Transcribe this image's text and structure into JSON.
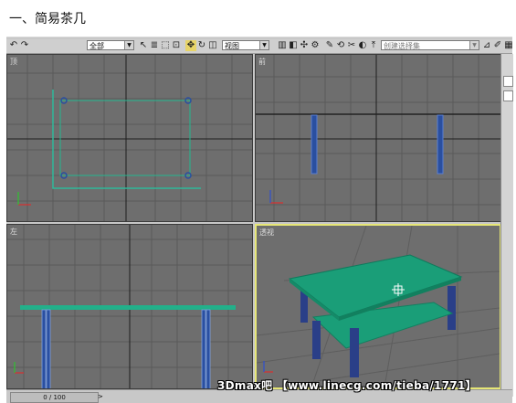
{
  "heading": "一、简易茶几",
  "toolbar": {
    "filter_value": "全部",
    "view_value": "视图",
    "selection_set_placeholder": "创建选择集"
  },
  "viewports": {
    "top": {
      "label": "顶"
    },
    "front": {
      "label": "前"
    },
    "left": {
      "label": "左"
    },
    "perspective": {
      "label": "透视",
      "active": true
    }
  },
  "status": {
    "time_slider": "0 / 100"
  },
  "watermark": "3Dmax吧 【www.linecg.com/tieba/1771】",
  "colors": {
    "viewport_bg": "#6e6e6e",
    "grid": "#5c5c5c",
    "tabletop": "#1a9e78",
    "legs": "#2a4fa0",
    "active_border": "#e6e676"
  }
}
